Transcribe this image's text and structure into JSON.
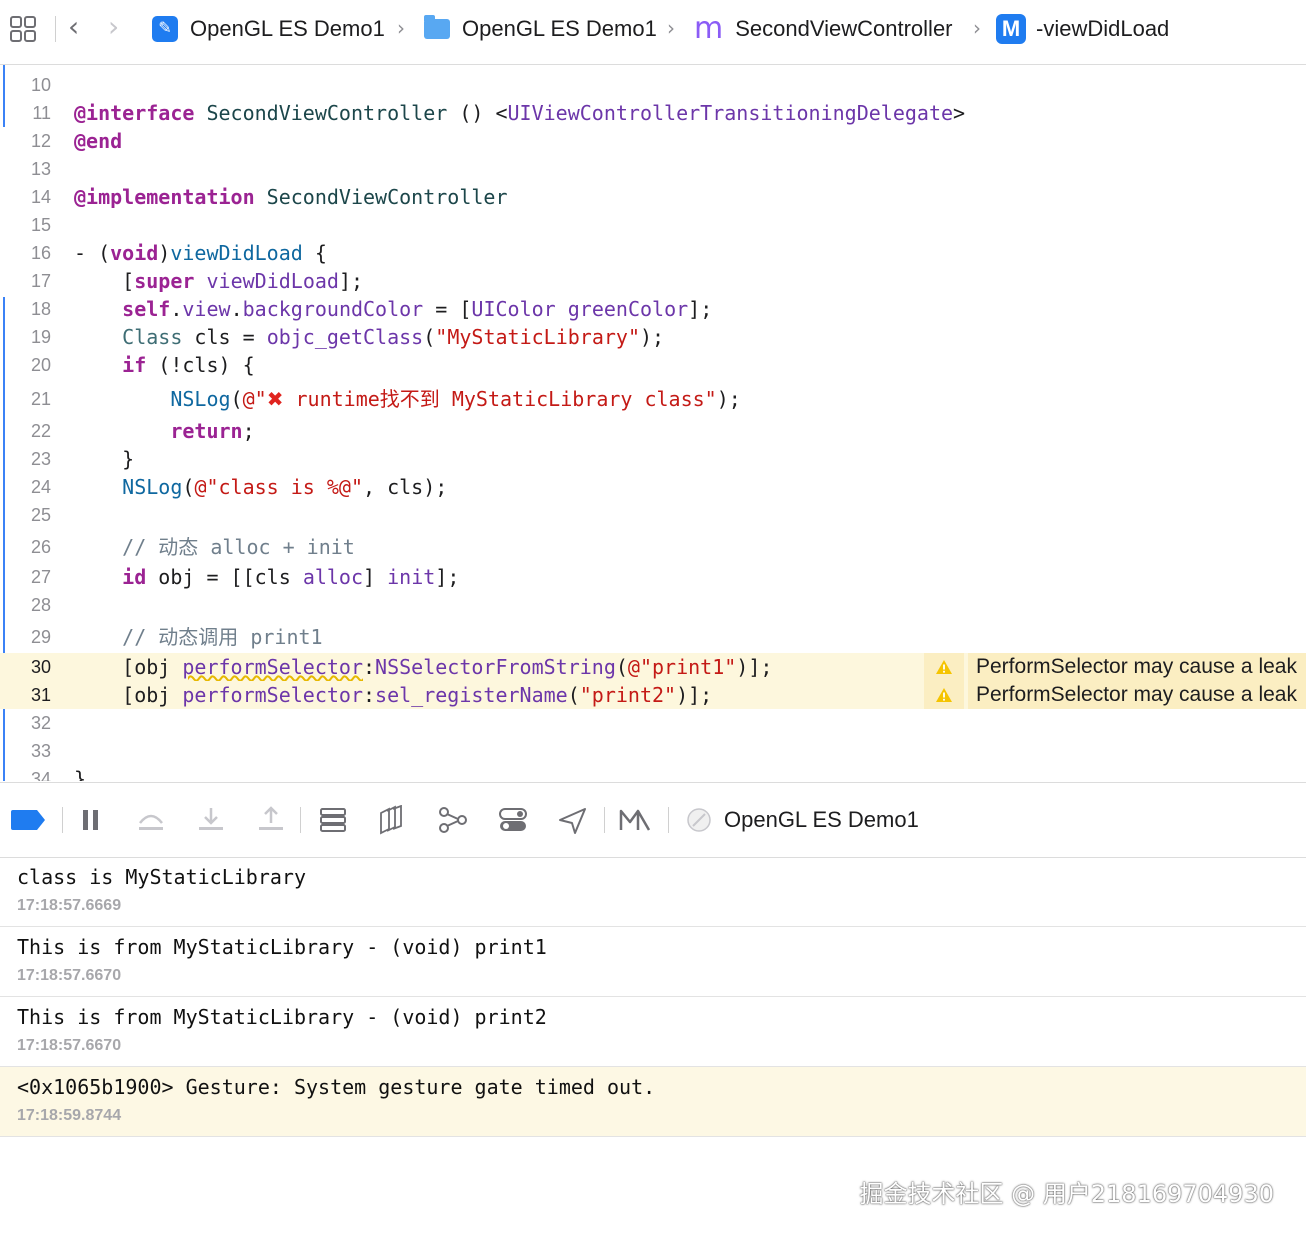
{
  "jumpbar": {
    "crumbs": [
      {
        "label": "OpenGL ES Demo1",
        "icon": "xcode-project-icon"
      },
      {
        "label": "OpenGL ES Demo1",
        "icon": "folder-icon"
      },
      {
        "label": "SecondViewController",
        "icon": "m-file-icon"
      },
      {
        "label": "-viewDidLoad",
        "icon": "method-icon"
      }
    ],
    "method_badge": "M",
    "impl_badge": "m"
  },
  "editor": {
    "line_numbers": [
      "10",
      "11",
      "12",
      "13",
      "14",
      "15",
      "16",
      "17",
      "18",
      "19",
      "20",
      "21",
      "22",
      "23",
      "24",
      "25",
      "26",
      "27",
      "28",
      "29",
      "30",
      "31",
      "32",
      "33",
      "34"
    ],
    "warnings": [
      {
        "line": "30",
        "message": "PerformSelector may cause a leak"
      },
      {
        "line": "31",
        "message": "PerformSelector may cause a leak"
      }
    ]
  },
  "debugbar": {
    "target_label": "OpenGL ES Demo1"
  },
  "console": {
    "entries": [
      {
        "message": "class is MyStaticLibrary",
        "time": "17:18:57.6669"
      },
      {
        "message": "This is from MyStaticLibrary - (void) print1",
        "time": "17:18:57.6670"
      },
      {
        "message": "This is from MyStaticLibrary - (void) print2",
        "time": "17:18:57.6670"
      },
      {
        "message": "<0x1065b1900> Gesture: System gesture gate timed out.",
        "time": "17:18:59.8744"
      }
    ]
  },
  "watermark": "掘金技术社区 @ 用户218169704930",
  "colors": {
    "accent": "#1f7cf0",
    "warning_bg": "#fbeec2",
    "keyword": "#9b2393",
    "string": "#c41a16"
  }
}
